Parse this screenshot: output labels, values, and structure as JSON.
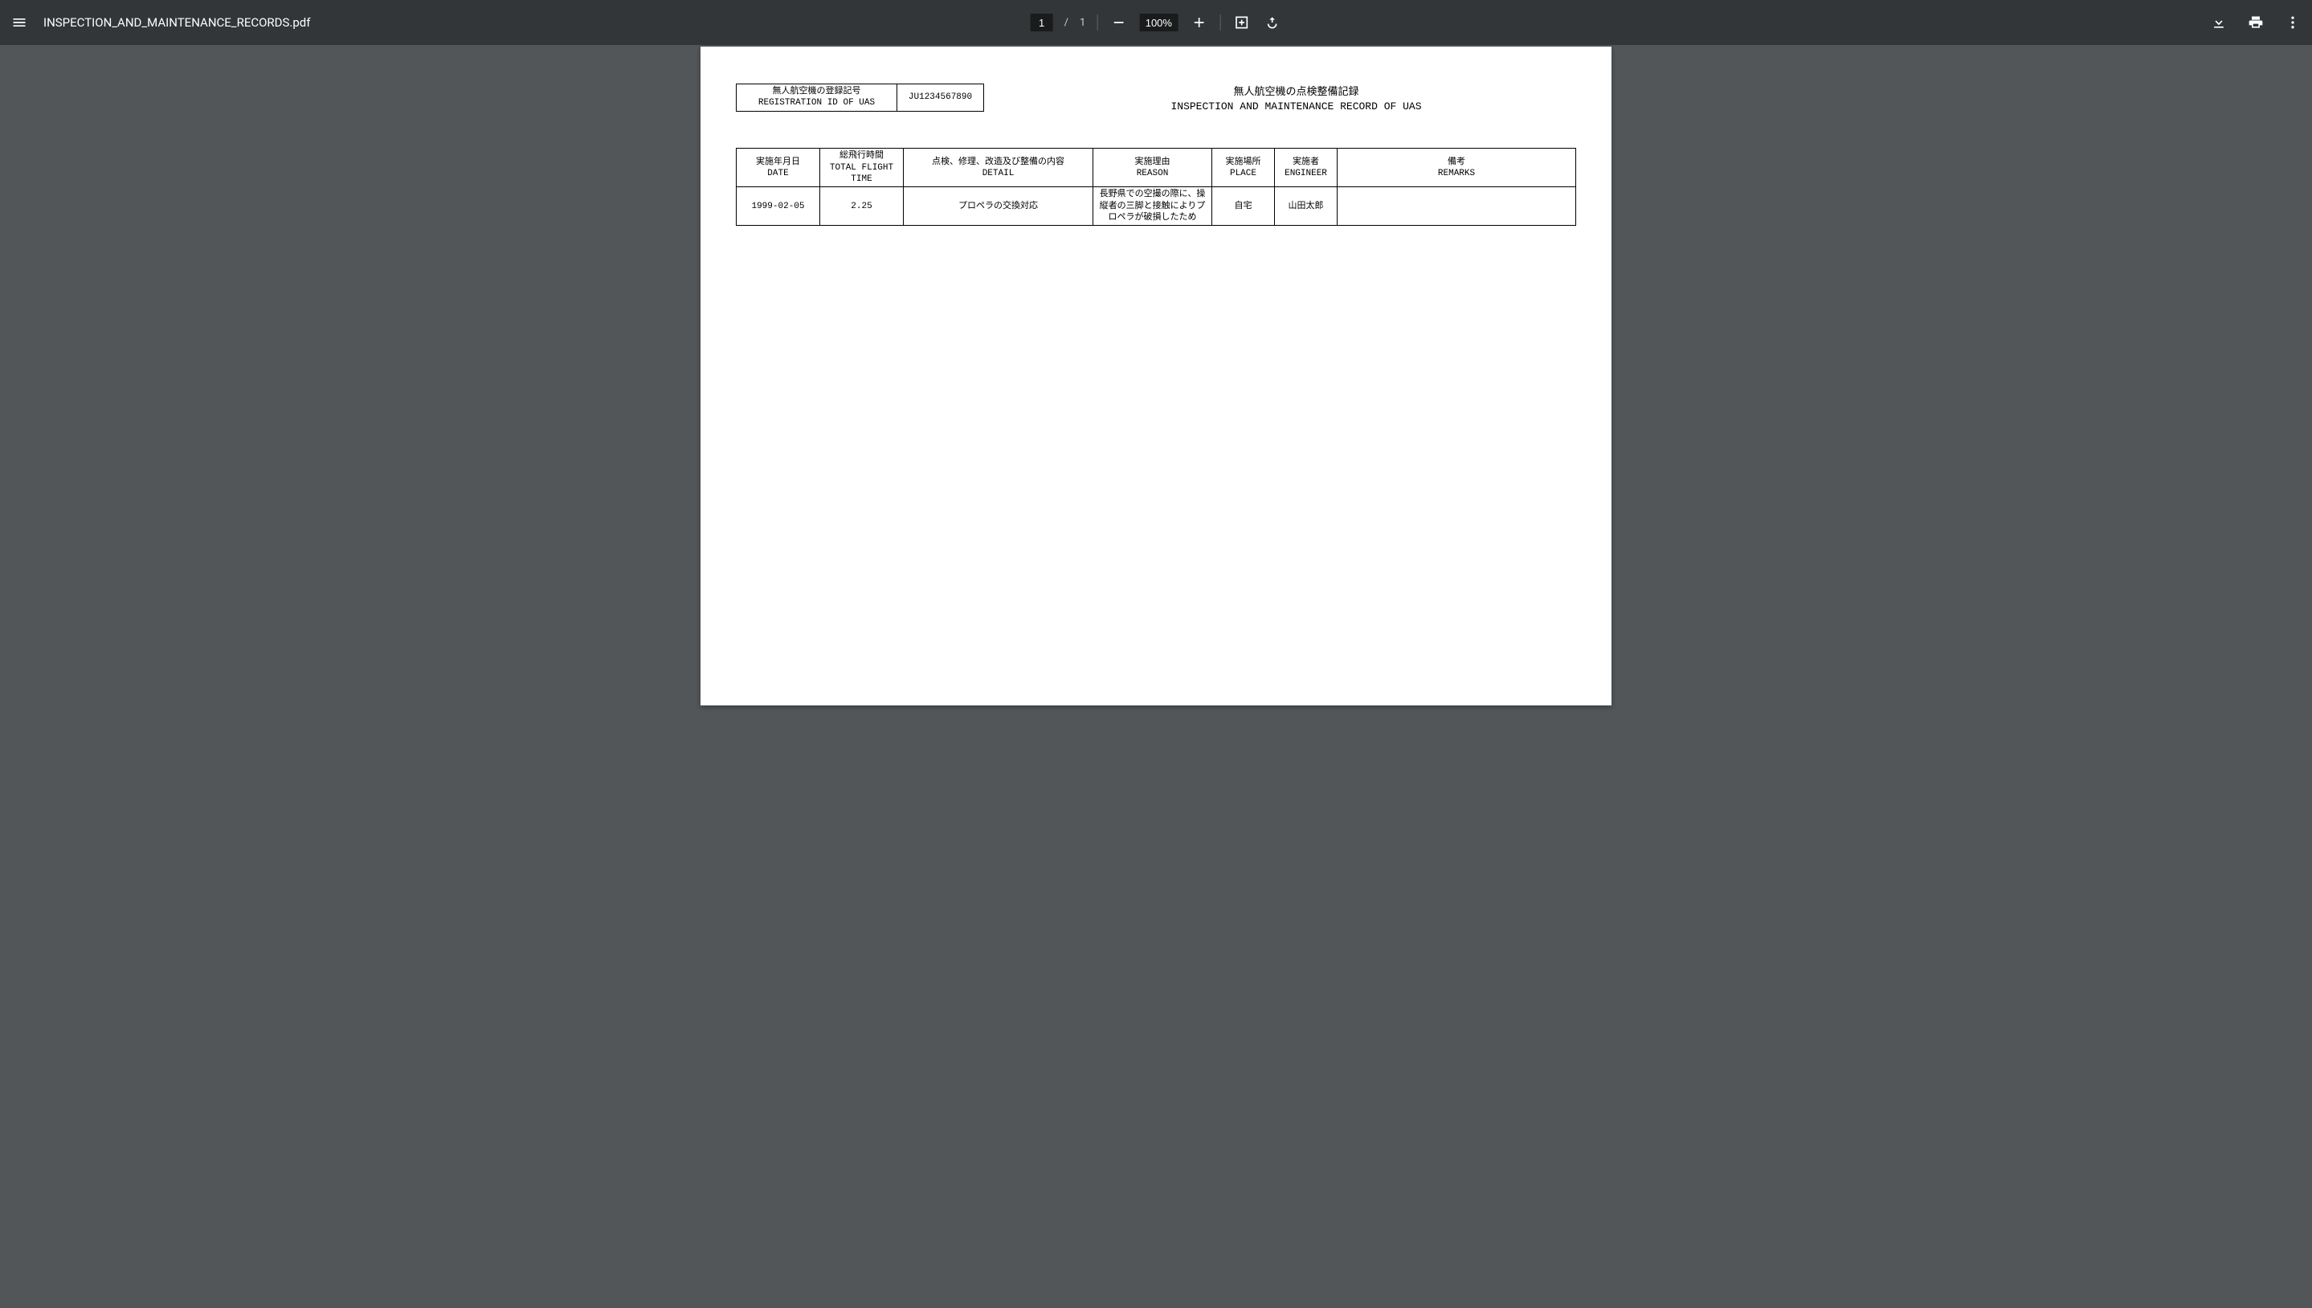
{
  "toolbar": {
    "filename": "INSPECTION_AND_MAINTENANCE_RECORDS.pdf",
    "page_current": "1",
    "page_sep": "/",
    "page_total": "1",
    "zoom": "100%"
  },
  "doc": {
    "reg_label_jp": "無人航空機の登録記号",
    "reg_label_en": "REGISTRATION ID OF UAS",
    "reg_value": "JU1234567890",
    "title_jp": "無人航空機の点検整備記録",
    "title_en": "INSPECTION AND MAINTENANCE RECORD OF UAS",
    "headers": {
      "date_jp": "実施年月日",
      "date_en": "DATE",
      "time_jp": "総飛行時間",
      "time_en": "TOTAL FLIGHT TIME",
      "detail_jp": "点検、修理、改造及び整備の内容",
      "detail_en": "DETAIL",
      "reason_jp": "実施理由",
      "reason_en": "REASON",
      "place_jp": "実施場所",
      "place_en": "PLACE",
      "engineer_jp": "実施者",
      "engineer_en": "ENGINEER",
      "remarks_jp": "備考",
      "remarks_en": "REMARKS"
    },
    "rows": [
      {
        "date": "1999-02-05",
        "time": "2.25",
        "detail": "プロペラの交換対応",
        "reason": "長野県での空撮の際に、操縦者の三脚と接触によりプロペラが破損したため",
        "place": "自宅",
        "engineer": "山田太郎",
        "remarks": ""
      }
    ]
  }
}
